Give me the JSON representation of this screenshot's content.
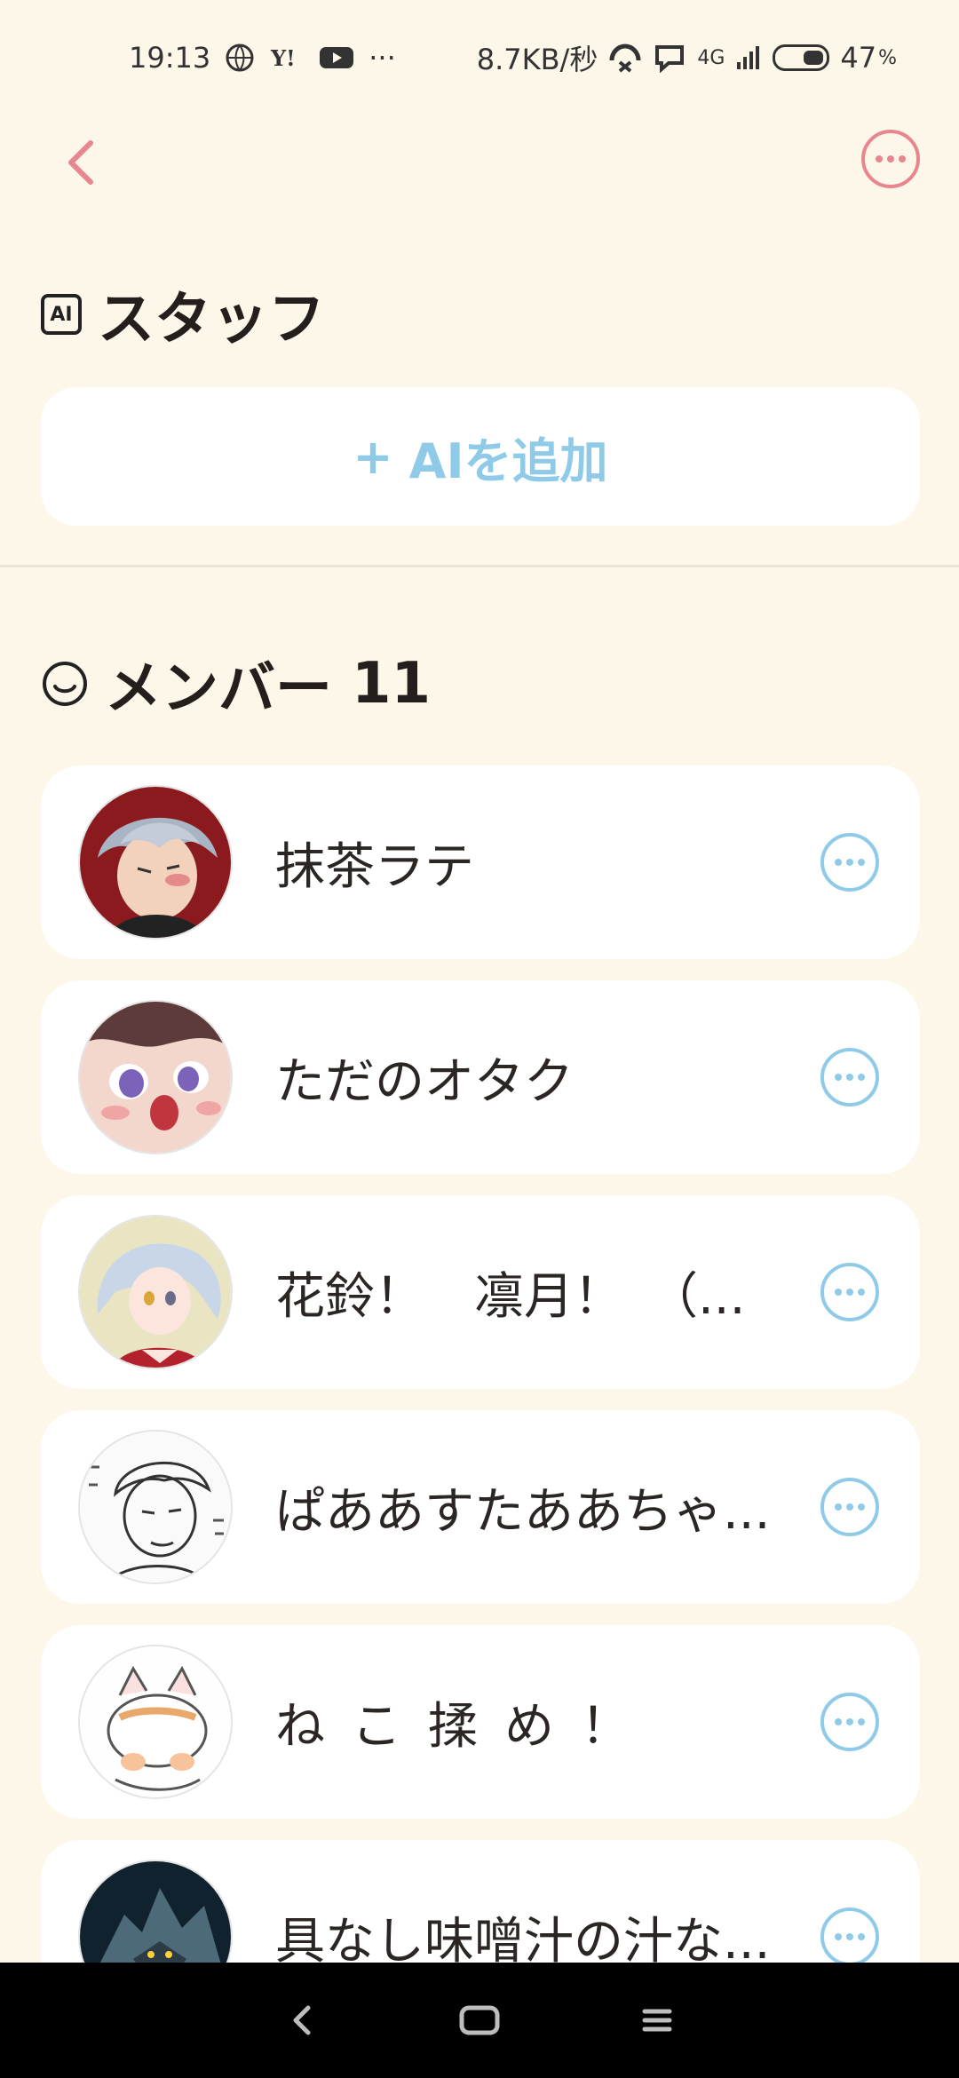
{
  "status_bar": {
    "time": "19:13",
    "left_icons": [
      "vpn-globe-icon",
      "yahoo-icon",
      "youtube-icon"
    ],
    "overflow": "···",
    "speed": "8.7KB/秒",
    "signal_label": "4G",
    "battery": "47",
    "battery_unit": "%"
  },
  "header": {
    "back_icon": "chevron-left-icon",
    "more_icon": "more-circle-icon",
    "accent_color": "#e8868f"
  },
  "staff_section": {
    "badge": "AI",
    "title": "スタッフ",
    "add_button_plus": "+",
    "add_button_label": "AIを追加"
  },
  "member_section": {
    "title": "メンバー",
    "count": "11",
    "members": [
      {
        "name": "抹茶ラテ",
        "avatar": "anime-avatar-silver-hair"
      },
      {
        "name": "ただのオタク",
        "avatar": "anime-avatar-purple-eyes"
      },
      {
        "name": "花鈴！　凛月！　（...",
        "avatar": "anime-avatar-white-hair"
      },
      {
        "name": "ぱああすたああちゃ...",
        "avatar": "sketch-avatar-manga"
      },
      {
        "name": "ねこ揉め！",
        "avatar": "cat-avatar-drawing"
      },
      {
        "name": "具なし味噌汁の汁な...",
        "avatar": "robot-avatar-dark"
      }
    ],
    "more_icon_color": "#8fcbe8"
  },
  "nav_bar": {
    "back": "nav-back-icon",
    "home": "nav-home-icon",
    "menu": "nav-menu-icon"
  }
}
